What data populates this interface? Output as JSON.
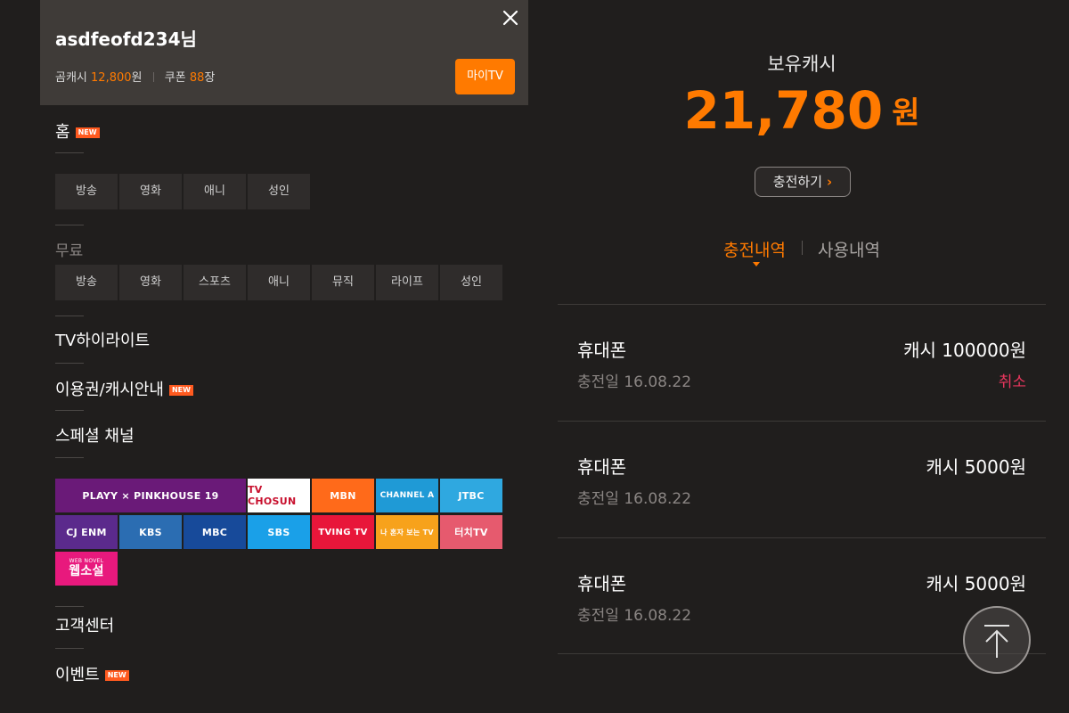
{
  "menu": {
    "username": "asdfeofd234님",
    "stats": {
      "gomcash_label": "곰캐시",
      "gomcash_value": "12,800",
      "gomcash_unit": "원",
      "coupon_label": "쿠폰",
      "coupon_value": "88",
      "coupon_unit": "장"
    },
    "mytv_label": "마이TV",
    "home": {
      "label": "홈",
      "badge": "NEW"
    },
    "home_categories": [
      "방송",
      "영화",
      "애니",
      "성인"
    ],
    "free": {
      "label": "무료",
      "categories": [
        "방송",
        "영화",
        "스포츠",
        "애니",
        "뮤직",
        "라이프",
        "성인"
      ]
    },
    "highlight": "TV하이라이트",
    "ticket": {
      "label": "이용권/캐시안내",
      "badge": "NEW"
    },
    "special": "스페셜 채널",
    "channels": [
      {
        "name": "PLAYY × PINKHOUSE 19",
        "color": "#6a1a78"
      },
      {
        "name": "TV CHOSUN",
        "color": "#ffffff"
      },
      {
        "name": "MBN",
        "color": "#ff6a1a"
      },
      {
        "name": "CHANNEL A",
        "color": "#1f9ad6"
      },
      {
        "name": "JTBC",
        "color": "#2fa8e0"
      },
      {
        "name": "CJ ENM",
        "color": "#5b2a8c"
      },
      {
        "name": "KBS",
        "color": "#2b6db2"
      },
      {
        "name": "MBC",
        "color": "#174a9a"
      },
      {
        "name": "SBS",
        "color": "#1aa0e8"
      },
      {
        "name": "TVING TV",
        "color": "#e8163a"
      },
      {
        "name": "나 혼자 보는 TV",
        "color": "#f7a21b"
      },
      {
        "name": "터치TV",
        "color": "#e65a6e"
      },
      {
        "name": "웹소설",
        "color": "#e8197d",
        "sub": "WEB NOVEL"
      }
    ],
    "support": "고객센터",
    "event": {
      "label": "이벤트",
      "badge": "NEW"
    }
  },
  "wallet": {
    "title": "보유캐시",
    "amount": "21,780",
    "unit": "원",
    "charge_button": "충전하기",
    "tabs": {
      "charge": "충전내역",
      "usage": "사용내역"
    },
    "history": [
      {
        "method": "휴대폰",
        "date": "충전일 16.08.22",
        "amount": "캐시 100000원",
        "status": "취소"
      },
      {
        "method": "휴대폰",
        "date": "충전일 16.08.22",
        "amount": "캐시 5000원",
        "status": ""
      },
      {
        "method": "휴대폰",
        "date": "충전일 16.08.22",
        "amount": "캐시 5000원",
        "status": ""
      }
    ]
  },
  "colors": {
    "accent": "#ff7a00",
    "cancel": "#e8365d",
    "badge": "#ff5a1f",
    "panel": "#3f3b38",
    "background": "#201e1d"
  },
  "icons": {
    "close": "close-icon",
    "scroll_top": "arrow-up-icon"
  }
}
